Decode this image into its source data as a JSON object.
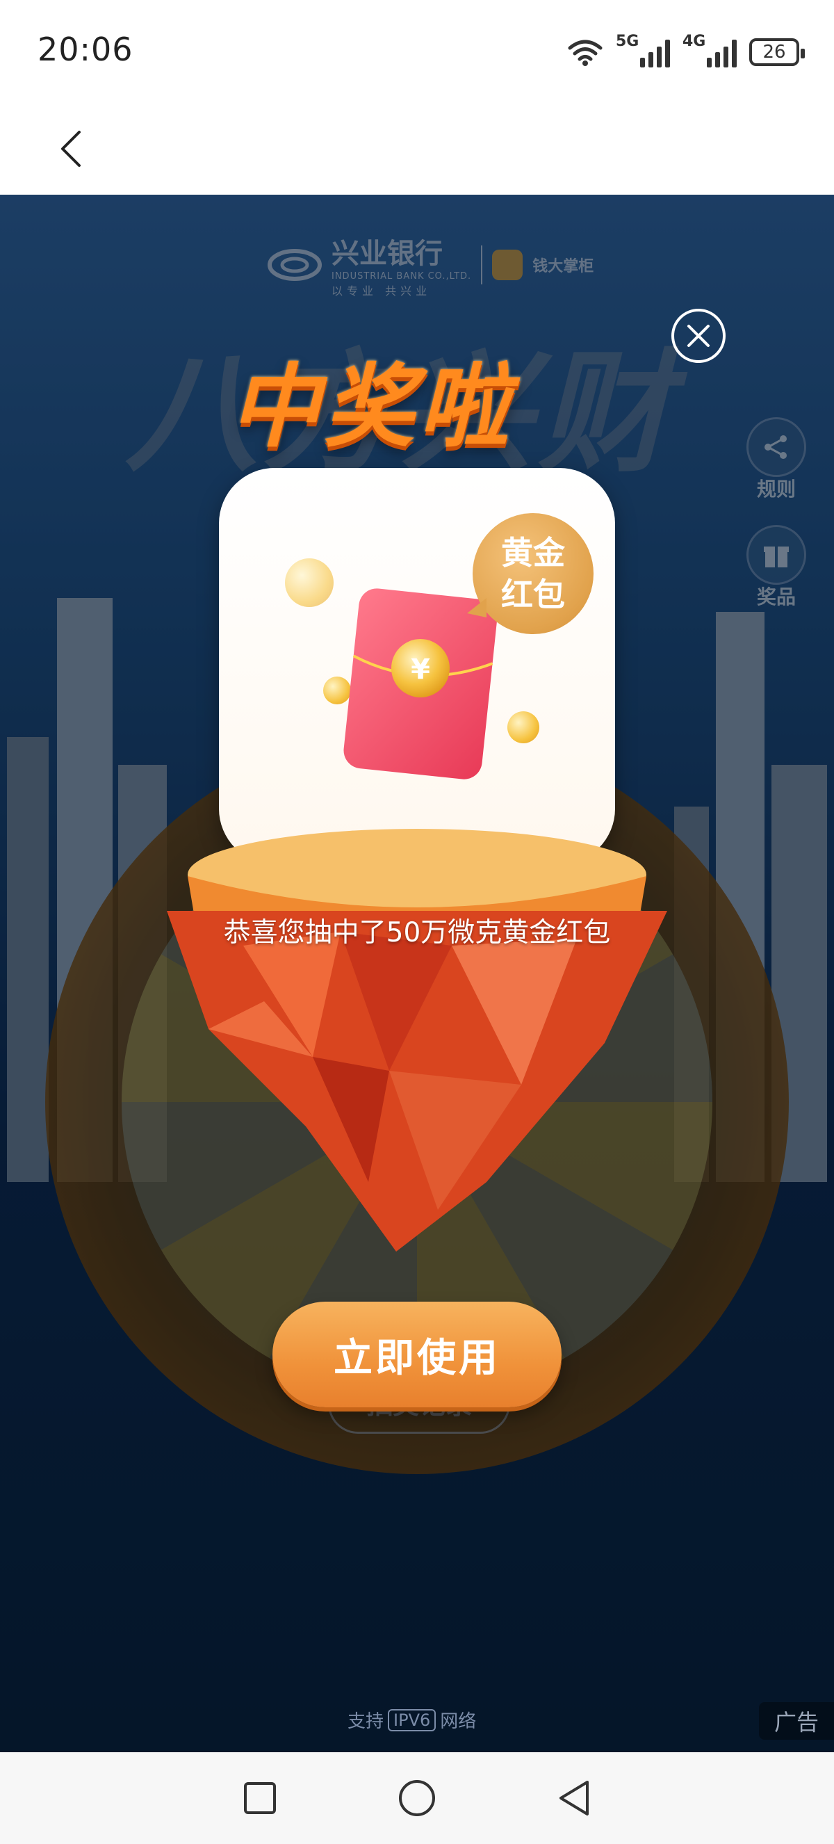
{
  "status_bar": {
    "time": "20:06",
    "network_1": "5G",
    "network_2": "4G",
    "battery": "26"
  },
  "background": {
    "bank_name": "兴业银行",
    "bank_name_en": "INDUSTRIAL BANK CO.,LTD.",
    "bank_slogan": "以专业 共兴业",
    "partner_name": "钱大掌柜",
    "title": "八方兴财",
    "side_rules": "规则",
    "side_prizes": "奖品",
    "records_button": "抽奖记录",
    "ipv6_prefix": "支持",
    "ipv6_label": "IPV6",
    "ipv6_suffix": "网络",
    "ad_tag": "广告"
  },
  "popup": {
    "title": "中奖啦",
    "badge_line1": "黄金",
    "badge_line2": "红包",
    "coin_symbol": "¥",
    "message": "恭喜您抽中了50万微克黄金红包",
    "use_button": "立即使用"
  },
  "icons": {
    "back": "chevron-left-icon",
    "close": "close-icon",
    "rules": "share-icon",
    "prizes": "gift-icon",
    "nav_recent": "square-icon",
    "nav_home": "circle-icon",
    "nav_back": "triangle-icon"
  },
  "colors": {
    "accent_orange": "#f0923a",
    "popup_title": "#ff8a1e",
    "badge_gold": "#e1a24c",
    "packet_red": "#ef4f6b",
    "page_bg": "#0b2a52"
  }
}
